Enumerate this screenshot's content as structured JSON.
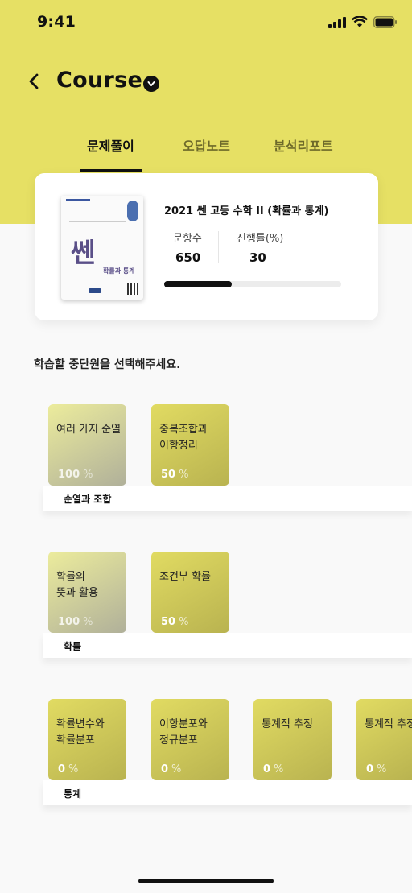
{
  "status": {
    "time": "9:41"
  },
  "header": {
    "title": "Course"
  },
  "tabs": [
    {
      "label": "문제풀이",
      "active": true
    },
    {
      "label": "오답노트",
      "active": false
    },
    {
      "label": "분석리포트",
      "active": false
    }
  ],
  "book": {
    "title": "2021 쎈 고등 수학 II (확률과 통계)",
    "cover_brand": "쎈",
    "cover_subtitle": "확률과 통계",
    "problem_count_label": "문항수",
    "problem_count": "650",
    "progress_label": "진행률(%)",
    "progress": "30",
    "progress_fraction": 0.38
  },
  "instruction": "학습할 중단원을 선택해주세요.",
  "sections": [
    {
      "label": "순열과 조합",
      "units": [
        {
          "name": "여러 가지 순열",
          "pct": "100",
          "style": "gray"
        },
        {
          "name": "중복조합과\n이항정리",
          "pct": "50",
          "style": "olive"
        }
      ]
    },
    {
      "label": "확률",
      "units": [
        {
          "name": "확률의\n뜻과 활용",
          "pct": "100",
          "style": "gray"
        },
        {
          "name": "조건부 확률",
          "pct": "50",
          "style": "olive"
        }
      ]
    },
    {
      "label": "통계",
      "units": [
        {
          "name": "확률변수와\n확률분포",
          "pct": "0",
          "style": "olive"
        },
        {
          "name": "이항분포와\n정규분포",
          "pct": "0",
          "style": "olive"
        },
        {
          "name": "통계적 추정",
          "pct": "0",
          "style": "olive"
        },
        {
          "name": "통계적 추정",
          "pct": "0",
          "style": "olive"
        }
      ]
    }
  ],
  "percent_symbol": "%",
  "colors": {
    "header": "#e6e064",
    "card_gray": "#c9c9a0",
    "card_olive": "#d0ca5a"
  }
}
